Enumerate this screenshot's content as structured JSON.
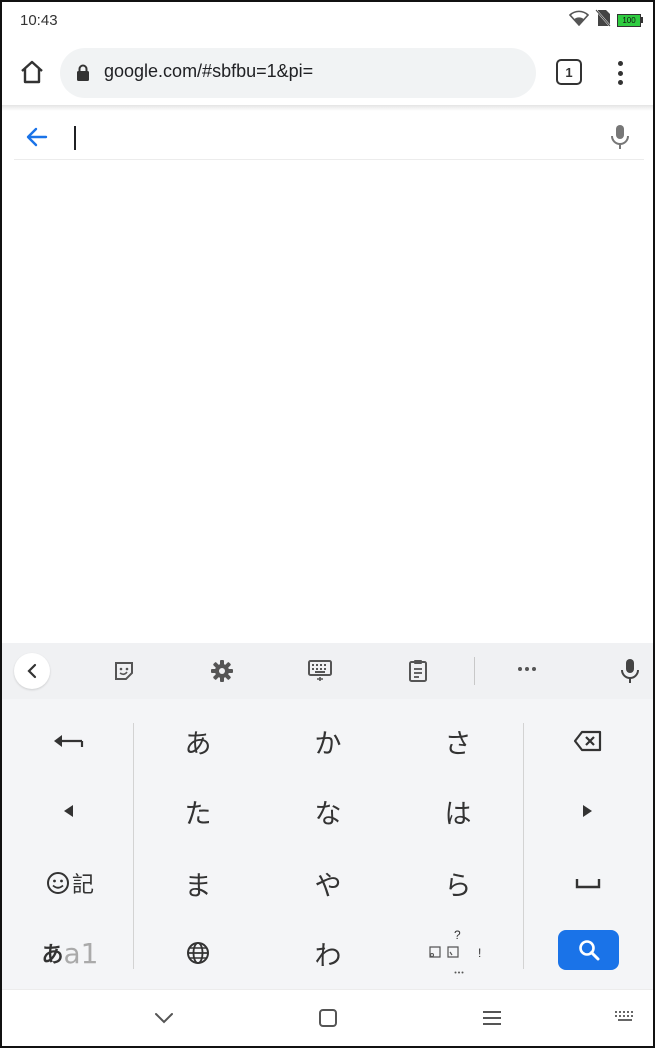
{
  "status": {
    "time": "10:43",
    "battery_label": "100",
    "icons": [
      "wifi-icon",
      "no-sim-icon",
      "battery-icon"
    ]
  },
  "browser": {
    "url": "google.com/#sbfbu=1&pi=",
    "tab_count": "1",
    "icons": [
      "home-icon",
      "lock-icon",
      "tab-switcher-icon",
      "overflow-menu-icon"
    ]
  },
  "search": {
    "value": "",
    "placeholder": "",
    "icons": [
      "back-arrow-icon",
      "microphone-icon"
    ]
  },
  "keyboard": {
    "toolbar_icons": [
      "chevron-left-icon",
      "sticker-icon",
      "gear-icon",
      "keyboard-icon",
      "clipboard-icon",
      "more-icon",
      "microphone-icon"
    ],
    "kana": {
      "a": "あ",
      "ka": "か",
      "sa": "さ",
      "ta": "た",
      "na": "な",
      "ha": "は",
      "ma": "ま",
      "ya": "や",
      "ra": "ら",
      "wa": "わ"
    },
    "kigo_label": "記",
    "eisu_kana": "あ",
    "eisu_latin": "a1",
    "punct": {
      "question": "?",
      "exclaim": "!"
    },
    "accent_color": "#1a73e8"
  },
  "nav": {
    "icons": [
      "chevron-down-icon",
      "square-icon",
      "hamburger-icon",
      "keyboard-small-icon"
    ]
  }
}
